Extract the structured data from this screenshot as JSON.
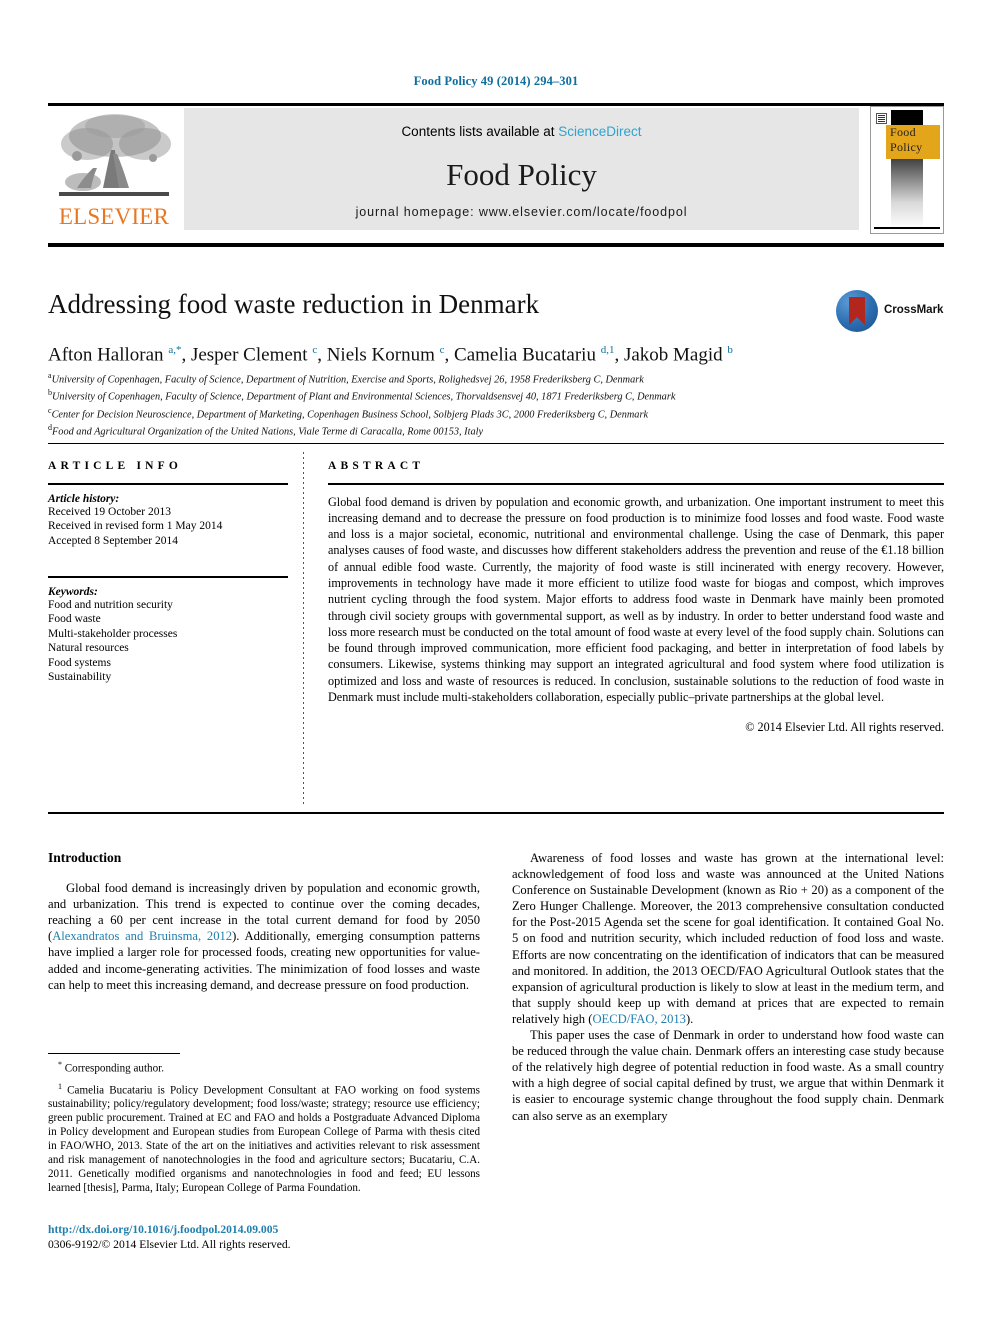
{
  "running_head": "Food Policy 49 (2014) 294–301",
  "masthead": {
    "contents_prefix": "Contents lists available at ",
    "sciencedirect": "ScienceDirect",
    "journal_name": "Food Policy",
    "homepage": "journal homepage: www.elsevier.com/locate/foodpol",
    "publisher": "ELSEVIER",
    "cover_title_line1": "Food",
    "cover_title_line2": "Policy"
  },
  "article": {
    "title": "Addressing food waste reduction in Denmark",
    "crossmark_label": "CrossMark",
    "authors_html": "Afton Halloran <sup>a,*</sup>, Jesper Clement <sup>c</sup>, Niels Kornum <sup>c</sup>, Camelia Bucatariu <sup>d,1</sup>, Jakob Magid <sup>b</sup>",
    "affiliations": [
      {
        "mark": "a",
        "text": "University of Copenhagen, Faculty of Science, Department of Nutrition, Exercise and Sports, Rolighedsvej 26, 1958 Frederiksberg C, Denmark"
      },
      {
        "mark": "b",
        "text": "University of Copenhagen, Faculty of Science, Department of Plant and Environmental Sciences, Thorvaldsensvej 40, 1871 Frederiksberg C, Denmark"
      },
      {
        "mark": "c",
        "text": "Center for Decision Neuroscience, Department of Marketing, Copenhagen Business School, Solbjerg Plads 3C, 2000 Frederiksberg C, Denmark"
      },
      {
        "mark": "d",
        "text": "Food and Agricultural Organization of the United Nations, Viale Terme di Caracalla, Rome 00153, Italy"
      }
    ]
  },
  "article_info": {
    "heading": "ARTICLE INFO",
    "history_label": "Article history:",
    "history": [
      "Received 19 October 2013",
      "Received in revised form 1 May 2014",
      "Accepted 8 September 2014"
    ],
    "keywords_label": "Keywords:",
    "keywords": [
      "Food and nutrition security",
      "Food waste",
      "Multi-stakeholder processes",
      "Natural resources",
      "Food systems",
      "Sustainability"
    ]
  },
  "abstract": {
    "heading": "ABSTRACT",
    "text": "Global food demand is driven by population and economic growth, and urbanization. One important instrument to meet this increasing demand and to decrease the pressure on food production is to minimize food losses and food waste. Food waste and loss is a major societal, economic, nutritional and environmental challenge. Using the case of Denmark, this paper analyses causes of food waste, and discusses how different stakeholders address the prevention and reuse of the €1.18 billion of annual edible food waste. Currently, the majority of food waste is still incinerated with energy recovery. However, improvements in technology have made it more efficient to utilize food waste for biogas and compost, which improves nutrient cycling through the food system. Major efforts to address food waste in Denmark have mainly been promoted through civil society groups with governmental support, as well as by industry. In order to better understand food waste and loss more research must be conducted on the total amount of food waste at every level of the food supply chain. Solutions can be found through improved communication, more efficient food packaging, and better in interpretation of food labels by consumers. Likewise, systems thinking may support an integrated agricultural and food system where food utilization is optimized and loss and waste of resources is reduced. In conclusion, sustainable solutions to the reduction of food waste in Denmark must include multi-stakeholders collaboration, especially public–private partnerships at the global level.",
    "copyright": "© 2014 Elsevier Ltd. All rights reserved."
  },
  "body": {
    "intro_heading": "Introduction",
    "left_paragraph_1_a": "Global food demand is increasingly driven by population and economic growth, and urbanization. This trend is expected to continue over the coming decades, reaching a 60 per cent increase in the total current demand for food by 2050 (",
    "left_paragraph_1_ref": "Alexandratos and Bruinsma, 2012",
    "left_paragraph_1_b": "). Additionally, emerging consumption patterns have implied a larger role for processed foods, creating new opportunities for value-added and income-generating activities. The minimization of food losses and waste can help to meet this increasing demand, and decrease pressure on food production.",
    "right_paragraph_1_a": "Awareness of food losses and waste has grown at the international level: acknowledgement of food loss and waste was announced at the United Nations Conference on Sustainable Development (known as Rio + 20) as a component of the Zero Hunger Challenge. Moreover, the 2013 comprehensive consultation conducted for the Post-2015 Agenda set the scene for goal identification. It contained Goal No. 5 on food and nutrition security, which included reduction of food loss and waste. Efforts are now concentrating on the identification of indicators that can be measured and monitored. In addition, the 2013 OECD/FAO Agricultural Outlook states that the expansion of agricultural production is likely to slow at least in the medium term, and that supply should keep up with demand at prices that are expected to remain relatively high (",
    "right_paragraph_1_ref": "OECD/FAO, 2013",
    "right_paragraph_1_b": ").",
    "right_paragraph_2": "This paper uses the case of Denmark in order to understand how food waste can be reduced through the value chain. Denmark offers an interesting case study because of the relatively high degree of potential reduction in food waste. As a small country with a high degree of social capital defined by trust, we argue that within Denmark it is easier to encourage systemic change throughout the food supply chain. Denmark can also serve as an exemplary"
  },
  "footnotes": {
    "corresponding": "Corresponding author.",
    "corresponding_mark": "*",
    "note1_mark": "1",
    "note1": "Camelia Bucatariu is Policy Development Consultant at FAO working on food systems sustainability; policy/regulatory development; food loss/waste; strategy; resource use efficiency; green public procurement. Trained at EC and FAO and holds a Postgraduate Advanced Diploma in Policy development and European studies from European College of Parma with thesis cited in FAO/WHO, 2013. State of the art on the initiatives and activities relevant to risk assessment and risk management of nanotechnologies in the food and agriculture sectors; Bucatariu, C.A. 2011. Genetically modified organisms and nanotechnologies in food and feed; EU lessons learned [thesis], Parma, Italy; European College of Parma Foundation."
  },
  "doi": {
    "url": "http://dx.doi.org/10.1016/j.foodpol.2014.09.005",
    "issn_line": "0306-9192/© 2014 Elsevier Ltd. All rights reserved."
  },
  "colors": {
    "link_blue": "#1f7fae",
    "running_head_blue": "#0f6e9e",
    "sciencedirect_blue": "#2fa3d0",
    "elsevier_orange": "#E87722",
    "cover_gold": "#E3A51A",
    "band_grey": "#e6e6e6"
  }
}
